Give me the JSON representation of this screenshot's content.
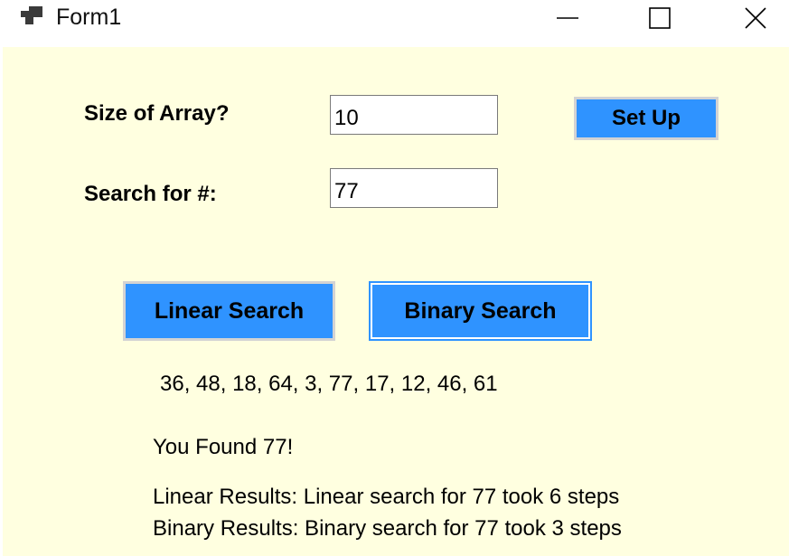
{
  "window": {
    "title": "Form1",
    "icon": "app-window-icon",
    "controls": [
      "minimize-icon",
      "maximize-icon",
      "close-icon"
    ]
  },
  "form": {
    "size_label": "Size of Array?",
    "size_value": "10",
    "search_label": "Search for #:",
    "search_value": "77",
    "setup_button": "Set Up",
    "linear_button": "Linear Search",
    "binary_button": "Binary Search",
    "array_output": "36, 48, 18, 64, 3, 77, 17, 12, 46, 61",
    "found_message": "You Found 77!",
    "linear_results": "Linear Results: Linear search for 77 took 6 steps",
    "binary_results": "Binary Results: Binary search for 77 took 3 steps"
  },
  "colors": {
    "background": "#ffffe0",
    "button": "#2f93ff"
  }
}
